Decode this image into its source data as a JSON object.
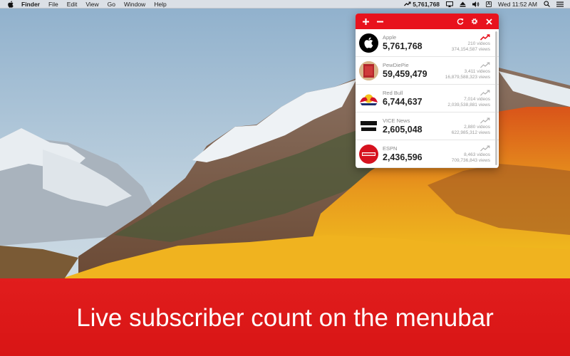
{
  "menubar": {
    "app_name": "Finder",
    "menus": [
      "File",
      "Edit",
      "View",
      "Go",
      "Window",
      "Help"
    ],
    "status_count": "5,761,768",
    "clock": "Wed 11:52 AM",
    "input_source": "A",
    "status_icons": [
      "trend-up-icon",
      "airplay-icon",
      "eject-icon",
      "volume-icon",
      "input-source-icon",
      "search-icon",
      "list-icon"
    ]
  },
  "popover": {
    "header_icons": [
      "plus-icon",
      "minus-icon",
      "refresh-icon",
      "gear-icon",
      "close-icon"
    ],
    "accent_color": "#e8121d",
    "channels": [
      {
        "name": "Apple",
        "count": "5,761,768",
        "videos": "210 videos",
        "views": "374,154,587 views",
        "trend": "up",
        "avatar": "apple-logo-icon"
      },
      {
        "name": "PewDiePie",
        "count": "59,459,479",
        "videos": "3,411 videos",
        "views": "16,879,588,323 views",
        "trend": "flat",
        "avatar": "pewdiepie-avatar"
      },
      {
        "name": "Red Bull",
        "count": "6,744,637",
        "videos": "7,014 videos",
        "views": "2,039,538,881 views",
        "trend": "flat",
        "avatar": "redbull-logo-icon"
      },
      {
        "name": "VICE News",
        "count": "2,605,048",
        "videos": "2,880 videos",
        "views": "622,985,312 views",
        "trend": "flat",
        "avatar": "vice-news-logo-icon"
      },
      {
        "name": "ESPN",
        "count": "2,436,596",
        "videos": "8,463 videos",
        "views": "709,736,843 views",
        "trend": "flat",
        "avatar": "espn-logo-icon"
      }
    ]
  },
  "banner": {
    "caption": "Live subscriber count on the menubar",
    "color": "#e11d1d"
  }
}
